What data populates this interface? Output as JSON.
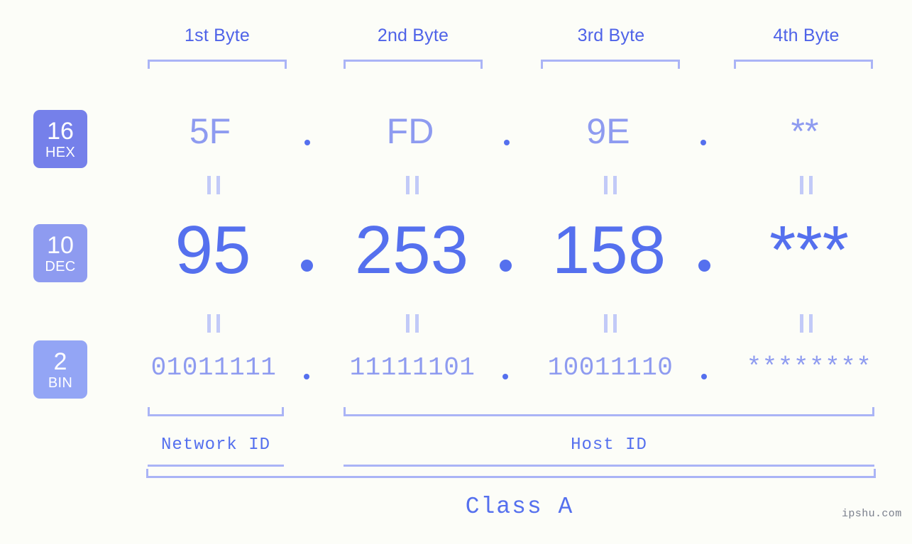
{
  "page": {
    "background": "#fcfdf8",
    "accent_strong": "#5570ee",
    "accent_mid": "#8e9bf0",
    "accent_light": "#aab4f6",
    "watermark": "ipshu.com"
  },
  "byte_headers": [
    {
      "label": "1st Byte"
    },
    {
      "label": "2nd Byte"
    },
    {
      "label": "3rd Byte"
    },
    {
      "label": "4th Byte"
    }
  ],
  "bases": [
    {
      "num": "16",
      "name": "HEX",
      "color": "#7580ea"
    },
    {
      "num": "10",
      "name": "DEC",
      "color": "#8e9bf0"
    },
    {
      "num": "2",
      "name": "BIN",
      "color": "#93a5f5"
    }
  ],
  "rows": {
    "hex": {
      "values": [
        "5F",
        "FD",
        "9E",
        "**"
      ],
      "separator": "."
    },
    "dec": {
      "values": [
        "95",
        "253",
        "158",
        "***"
      ],
      "separator": "."
    },
    "bin": {
      "values": [
        "01011111",
        "11111101",
        "10011110",
        "********"
      ],
      "separator": "."
    }
  },
  "equals_marks": {
    "symbol": "||",
    "count_per_row": 4
  },
  "footer": {
    "network_id": "Network ID",
    "host_id": "Host ID",
    "class": "Class A"
  }
}
